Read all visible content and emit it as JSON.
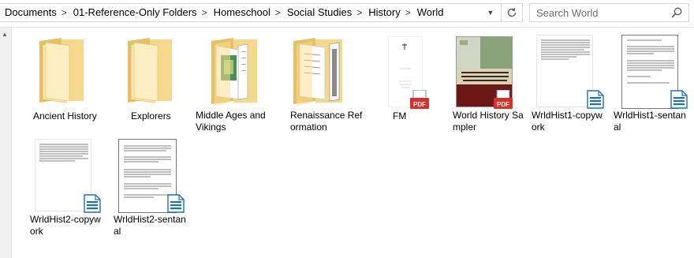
{
  "breadcrumb": [
    "Documents",
    "01-Reference-Only Folders",
    "Homeschool",
    "Social Studies",
    "History",
    "World"
  ],
  "separator": ">",
  "search": {
    "placeholder": "Search World"
  },
  "icons": {
    "search": "search-icon",
    "refresh": "refresh-icon",
    "dropdown": "chevron-down-icon",
    "folder": "folder-icon",
    "pdf": "pdf-icon",
    "writer": "writer-document-icon"
  },
  "colors": {
    "folder": "#f4d57a",
    "folder_dark": "#e2b94a",
    "pdf_red": "#d9302a",
    "writer_blue": "#1e6fb8"
  },
  "items": [
    {
      "name": "Ancient History",
      "type": "folder"
    },
    {
      "name": "Explorers",
      "type": "folder"
    },
    {
      "name": "Middle Ages and Vikings",
      "type": "folder"
    },
    {
      "name": "Renaissance Reformation",
      "type": "folder"
    },
    {
      "name": "FM",
      "type": "pdf"
    },
    {
      "name": "World History Sampler",
      "type": "pdf",
      "cover_title": "BLACKLINE MAPS OF WORLD HISTORY"
    },
    {
      "name": "WrldHist1-copywork",
      "type": "writer"
    },
    {
      "name": "WrldHist1-sentanal",
      "type": "writer"
    },
    {
      "name": "WrldHist2-copywork",
      "type": "writer"
    },
    {
      "name": "WrldHist2-sentanal",
      "type": "writer"
    }
  ]
}
